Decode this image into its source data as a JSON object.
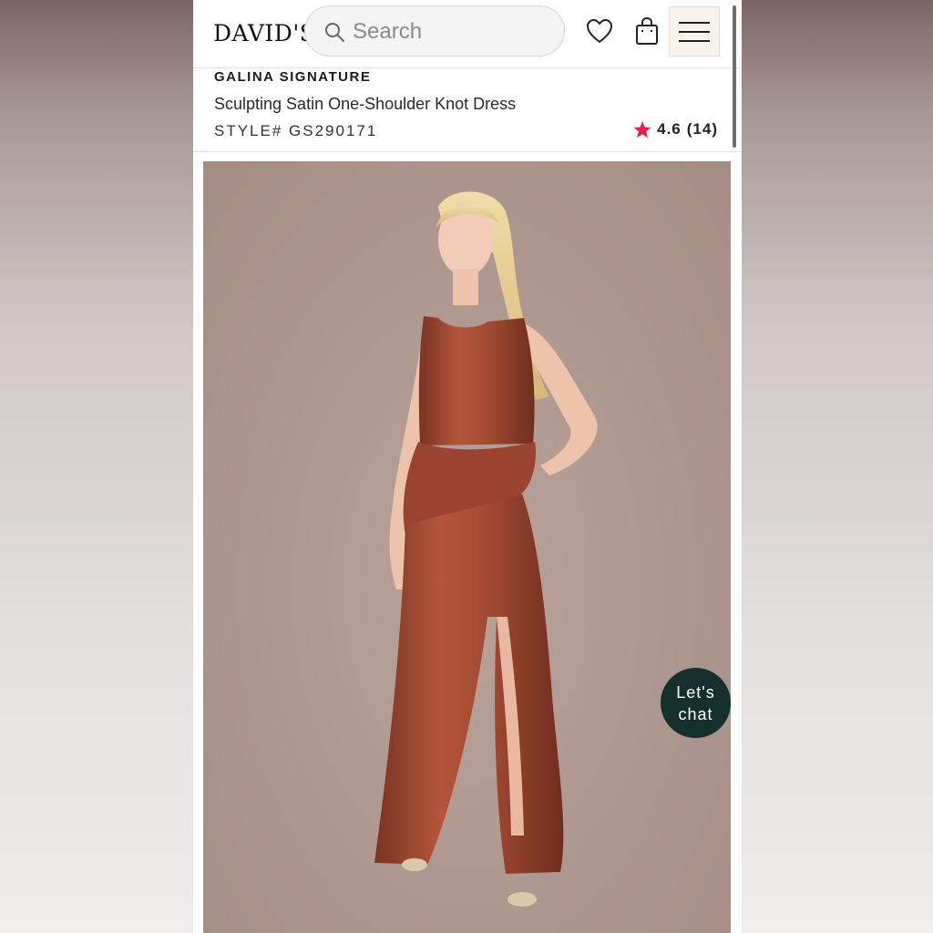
{
  "header": {
    "logo": "DAVID'S",
    "search": {
      "placeholder": "Search"
    },
    "icons": [
      "search-icon",
      "heart-icon",
      "bag-icon",
      "menu-icon"
    ]
  },
  "product": {
    "brand": "GALINA SIGNATURE",
    "title": "Sculpting Satin One-Shoulder Knot Dress",
    "style": "STYLE# GS290171",
    "rating": "4.6",
    "review_count": "(14)"
  },
  "chat": {
    "line1": "Let's",
    "line2": "chat"
  },
  "colors": {
    "rating_star": "#e5214a",
    "dress": "#a14a33",
    "backdrop": "#ad968d",
    "chat_bg": "#15302c"
  }
}
